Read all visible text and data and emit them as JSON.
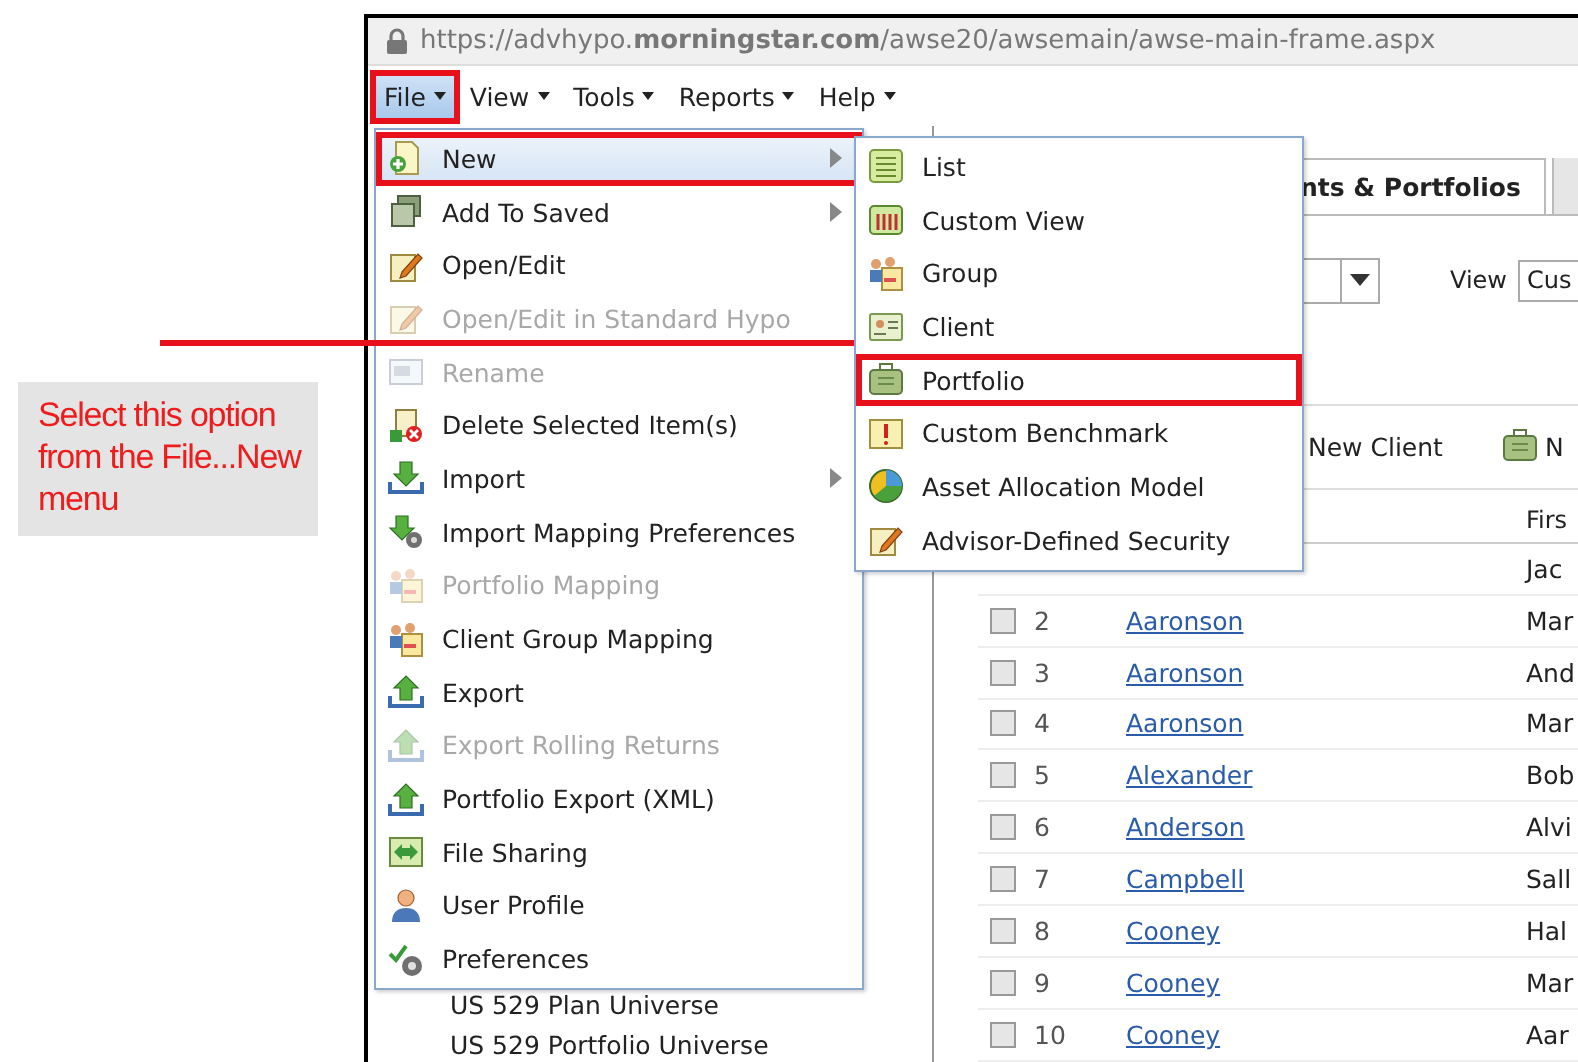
{
  "callout": {
    "text": "Select this option from the File...New menu"
  },
  "address_bar": {
    "url": "https://advhypo.**morningstar.com**/awse20/awsemain/awse-main-frame.aspx"
  },
  "menu_bar": [
    {
      "label": "File",
      "selected": true,
      "callout": true
    },
    {
      "label": "View",
      "selected": false,
      "callout": false
    },
    {
      "label": "Tools",
      "selected": false,
      "callout": false
    },
    {
      "label": "Reports",
      "selected": false,
      "callout": false
    },
    {
      "label": "Help",
      "selected": false,
      "callout": false
    }
  ],
  "file_menu": {
    "items": [
      {
        "label": "New",
        "disabled": false,
        "submenu": true,
        "selected": true,
        "callout": true
      },
      {
        "label": "Add To Saved",
        "disabled": false,
        "submenu": true,
        "selected": false,
        "callout": false
      },
      {
        "label": "Open/Edit",
        "disabled": false,
        "submenu": false,
        "selected": false,
        "callout": false
      },
      {
        "label": "Open/Edit in Standard Hypo",
        "disabled": true,
        "submenu": false,
        "selected": false,
        "callout": false
      },
      {
        "label": "Rename",
        "disabled": true,
        "submenu": false,
        "selected": false,
        "callout": false
      },
      {
        "label": "Delete Selected Item(s)",
        "disabled": false,
        "submenu": false,
        "selected": false,
        "callout": false
      },
      {
        "label": "Import",
        "disabled": false,
        "submenu": true,
        "selected": false,
        "callout": false
      },
      {
        "label": "Import Mapping Preferences",
        "disabled": false,
        "submenu": false,
        "selected": false,
        "callout": false
      },
      {
        "label": "Portfolio Mapping",
        "disabled": true,
        "submenu": false,
        "selected": false,
        "callout": false
      },
      {
        "label": "Client Group Mapping",
        "disabled": false,
        "submenu": false,
        "selected": false,
        "callout": false
      },
      {
        "label": "Export",
        "disabled": false,
        "submenu": false,
        "selected": false,
        "callout": false
      },
      {
        "label": "Export Rolling Returns",
        "disabled": true,
        "submenu": false,
        "selected": false,
        "callout": false
      },
      {
        "label": "Portfolio Export (XML)",
        "disabled": false,
        "submenu": false,
        "selected": false,
        "callout": false
      },
      {
        "label": "File Sharing",
        "disabled": false,
        "submenu": false,
        "selected": false,
        "callout": false
      },
      {
        "label": "User Profile",
        "disabled": false,
        "submenu": false,
        "selected": false,
        "callout": false
      },
      {
        "label": "Preferences",
        "disabled": false,
        "submenu": false,
        "selected": false,
        "callout": false
      }
    ]
  },
  "new_submenu": {
    "items": [
      {
        "label": "List",
        "selected": false,
        "callout": false
      },
      {
        "label": "Custom View",
        "selected": false,
        "callout": false
      },
      {
        "label": "Group",
        "selected": false,
        "callout": false
      },
      {
        "label": "Client",
        "selected": false,
        "callout": false
      },
      {
        "label": "Portfolio",
        "selected": false,
        "callout": true
      },
      {
        "label": "Custom Benchmark",
        "selected": false,
        "callout": false
      },
      {
        "label": "Asset Allocation Model",
        "selected": false,
        "callout": false
      },
      {
        "label": "Advisor-Defined Security",
        "selected": false,
        "callout": false
      }
    ]
  },
  "left_panel": {
    "items": [
      "US 529 Plan Universe",
      "US 529 Portfolio Universe"
    ]
  },
  "tab": {
    "label": "nts & Portfolios"
  },
  "filter": {
    "view_label": "View",
    "view_value": "Cus"
  },
  "toolbar": {
    "new_client": "New Client",
    "new_other": "N"
  },
  "table": {
    "columns": [
      "Firs"
    ],
    "rows": [
      {
        "first": "Jac"
      },
      {
        "checked": false,
        "number": "2",
        "name": "Aaronson",
        "first": "Mar"
      },
      {
        "checked": false,
        "number": "3",
        "name": "Aaronson",
        "first": "And"
      },
      {
        "checked": false,
        "number": "4",
        "name": "Aaronson",
        "first": "Mar"
      },
      {
        "checked": false,
        "number": "5",
        "name": "Alexander",
        "first": "Bob"
      },
      {
        "checked": false,
        "number": "6",
        "name": "Anderson",
        "first": "Alvi"
      },
      {
        "checked": false,
        "number": "7",
        "name": "Campbell",
        "first": "Sall"
      },
      {
        "checked": false,
        "number": "8",
        "name": "Cooney",
        "first": "Hal"
      },
      {
        "checked": false,
        "number": "9",
        "name": "Cooney",
        "first": "Mar"
      },
      {
        "checked": false,
        "number": "10",
        "name": "Cooney",
        "first": "Aar"
      }
    ]
  }
}
